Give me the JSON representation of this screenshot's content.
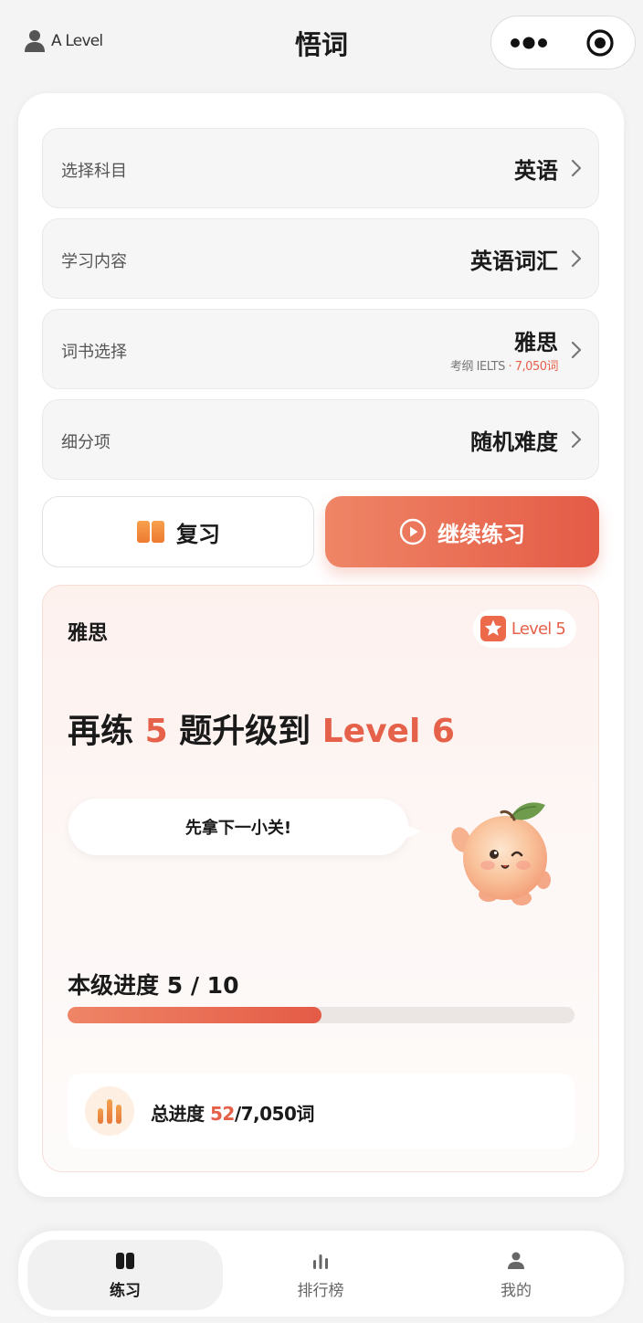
{
  "header": {
    "level_label": "A Level",
    "title": "悟词"
  },
  "settings": {
    "subject": {
      "label": "选择科目",
      "value": "英语"
    },
    "content": {
      "label": "学习内容",
      "value": "英语词汇"
    },
    "book": {
      "label": "词书选择",
      "value": "雅思",
      "sub_prefix": "考纲 IELTS",
      "sub_separator": "·",
      "sub_count": "7,050词"
    },
    "sub_item": {
      "label": "细分项",
      "value": "随机难度"
    }
  },
  "actions": {
    "review_label": "复习",
    "continue_label": "继续练习"
  },
  "progress_panel": {
    "book_name": "雅思",
    "current_level": "Level 5",
    "headline_prefix": "再练",
    "headline_count": "5",
    "headline_mid": "题升级到",
    "headline_target": "Level 6",
    "bubble_text": "先拿下一小关!",
    "level_progress_label": "本级进度",
    "level_progress_value": "5 / 10",
    "level_progress_fraction": 0.5,
    "total_label": "总进度",
    "total_done": "52",
    "total_rest": "/7,050词"
  },
  "tabbar": {
    "tabs": [
      {
        "label": "练习",
        "active": true
      },
      {
        "label": "排行榜",
        "active": false
      },
      {
        "label": "我的",
        "active": false
      }
    ]
  },
  "colors": {
    "accent": "#e5614a",
    "accent_light": "#ef8566",
    "background": "#f4f4f4"
  },
  "icons": [
    "user-icon",
    "more-icon",
    "target-icon",
    "chevron-right-icon",
    "book-icon",
    "play-icon",
    "star-icon",
    "mascot-peach",
    "bar-chart-icon",
    "practice-tab-icon",
    "ranking-tab-icon",
    "profile-tab-icon"
  ]
}
